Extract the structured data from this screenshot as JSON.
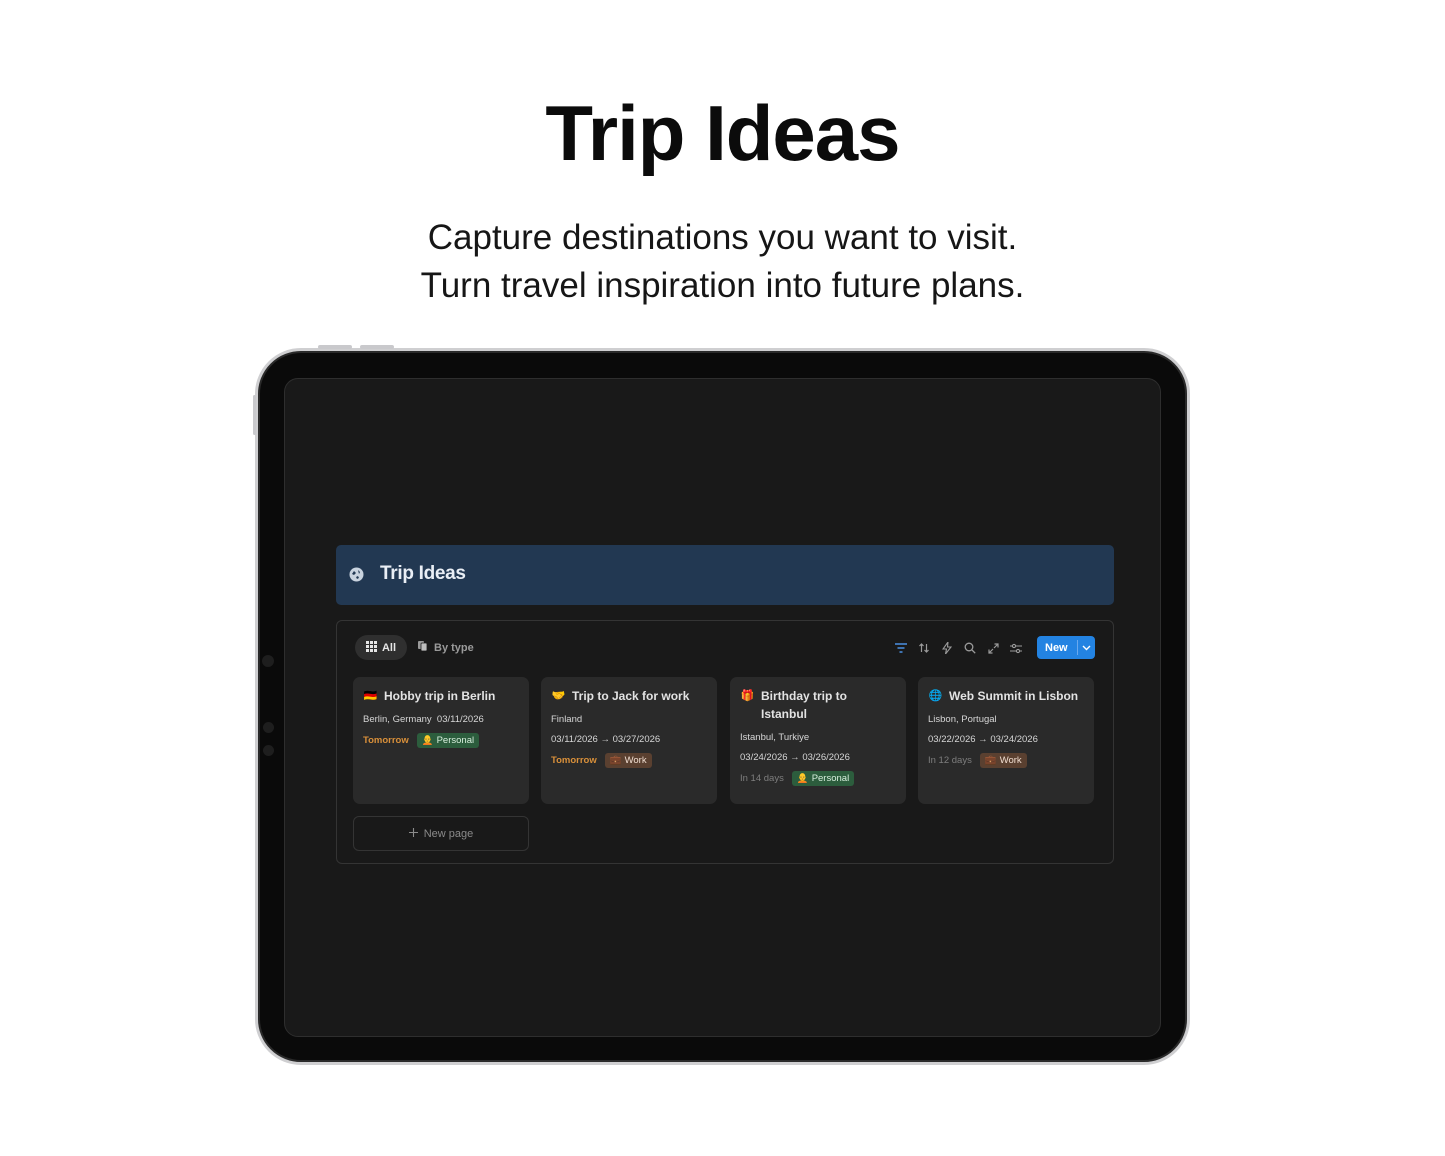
{
  "hero": {
    "title": "Trip Ideas",
    "subtitle_line1": "Capture destinations you want to visit.",
    "subtitle_line2": "Turn travel inspiration into future plans."
  },
  "page": {
    "title": "Trip Ideas",
    "icon": "travel-explore-icon",
    "banner_color": "#223852"
  },
  "views": [
    {
      "label": "All",
      "icon": "grid-icon",
      "active": true
    },
    {
      "label": "By type",
      "icon": "tag-stack-icon",
      "active": false
    }
  ],
  "toolbar": {
    "icons": [
      "filter-icon",
      "sort-icon",
      "automation-icon",
      "search-icon",
      "expand-icon",
      "settings-icon"
    ],
    "new_label": "New"
  },
  "cards": [
    {
      "emoji": "🇩🇪",
      "title": "Hobby trip in Berlin",
      "location": "Berlin, Germany",
      "dates": "03/11/2026",
      "when": "Tomorrow",
      "tag": "Personal",
      "tag_emoji": "🧑‍🦲"
    },
    {
      "emoji": "🤝",
      "title": "Trip to Jack for work",
      "location": "Finland",
      "dates": "03/11/2026 → 03/27/2026",
      "when": "Tomorrow",
      "tag": "Work",
      "tag_emoji": "💼"
    },
    {
      "emoji": "🎁",
      "title": "Birthday trip to Istanbul",
      "location": "Istanbul, Turkiye",
      "dates": "03/24/2026 → 03/26/2026",
      "when": "In 14 days",
      "tag": "Personal",
      "tag_emoji": "🧑‍🦲"
    },
    {
      "emoji": "🌐",
      "title": "Web Summit in Lisbon",
      "location": "Lisbon, Portugal",
      "dates": "03/22/2026 → 03/24/2026",
      "when": "In 12 days",
      "tag": "Work",
      "tag_emoji": "💼"
    }
  ],
  "new_page_label": "New page",
  "colors": {
    "accent": "#2383e2",
    "soon": "#d9903a",
    "personal_tag": "#2c5d3d",
    "work_tag": "#5a4030"
  }
}
